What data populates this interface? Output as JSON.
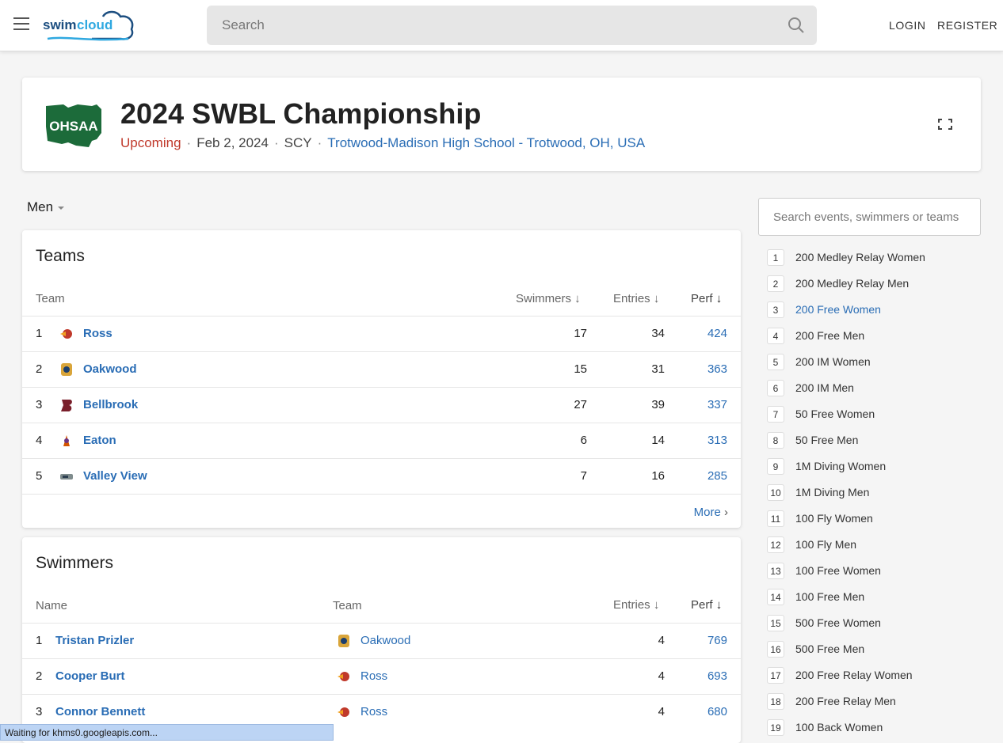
{
  "header": {
    "logo_text": "swimcloud",
    "search_placeholder": "Search",
    "login": "LOGIN",
    "register": "REGISTER"
  },
  "meet": {
    "logo_text": "OHSAA",
    "title": "2024 SWBL Championship",
    "status": "Upcoming",
    "date": "Feb 2, 2024",
    "course": "SCY",
    "location": "Trotwood-Madison High School - Trotwood, OH, USA"
  },
  "gender_select": "Men",
  "teams": {
    "heading": "Teams",
    "columns": [
      "Team",
      "Swimmers",
      "Entries",
      "Perf"
    ],
    "rows": [
      {
        "rank": "1",
        "name": "Ross",
        "swimmers": "17",
        "entries": "34",
        "perf": "424"
      },
      {
        "rank": "2",
        "name": "Oakwood",
        "swimmers": "15",
        "entries": "31",
        "perf": "363"
      },
      {
        "rank": "3",
        "name": "Bellbrook",
        "swimmers": "27",
        "entries": "39",
        "perf": "337"
      },
      {
        "rank": "4",
        "name": "Eaton",
        "swimmers": "6",
        "entries": "14",
        "perf": "313"
      },
      {
        "rank": "5",
        "name": "Valley View",
        "swimmers": "7",
        "entries": "16",
        "perf": "285"
      }
    ],
    "more": "More"
  },
  "swimmers": {
    "heading": "Swimmers",
    "columns": [
      "Name",
      "Team",
      "Entries",
      "Perf"
    ],
    "rows": [
      {
        "rank": "1",
        "name": "Tristan Prizler",
        "team": "Oakwood",
        "entries": "4",
        "perf": "769"
      },
      {
        "rank": "2",
        "name": "Cooper Burt",
        "team": "Ross",
        "entries": "4",
        "perf": "693"
      },
      {
        "rank": "3",
        "name": "Connor Bennett",
        "team": "Ross",
        "entries": "4",
        "perf": "680"
      }
    ]
  },
  "sidebar": {
    "search_placeholder": "Search events, swimmers or teams",
    "events": [
      {
        "num": "1",
        "name": "200 Medley Relay Women"
      },
      {
        "num": "2",
        "name": "200 Medley Relay Men"
      },
      {
        "num": "3",
        "name": "200 Free Women"
      },
      {
        "num": "4",
        "name": "200 Free Men"
      },
      {
        "num": "5",
        "name": "200 IM Women"
      },
      {
        "num": "6",
        "name": "200 IM Men"
      },
      {
        "num": "7",
        "name": "50 Free Women"
      },
      {
        "num": "8",
        "name": "50 Free Men"
      },
      {
        "num": "9",
        "name": "1M Diving Women"
      },
      {
        "num": "10",
        "name": "1M Diving Men"
      },
      {
        "num": "11",
        "name": "100 Fly Women"
      },
      {
        "num": "12",
        "name": "100 Fly Men"
      },
      {
        "num": "13",
        "name": "100 Free Women"
      },
      {
        "num": "14",
        "name": "100 Free Men"
      },
      {
        "num": "15",
        "name": "500 Free Women"
      },
      {
        "num": "16",
        "name": "500 Free Men"
      },
      {
        "num": "17",
        "name": "200 Free Relay Women"
      },
      {
        "num": "18",
        "name": "200 Free Relay Men"
      },
      {
        "num": "19",
        "name": "100 Back Women"
      }
    ]
  },
  "status_bar": "Waiting for khms0.googleapis.com..."
}
